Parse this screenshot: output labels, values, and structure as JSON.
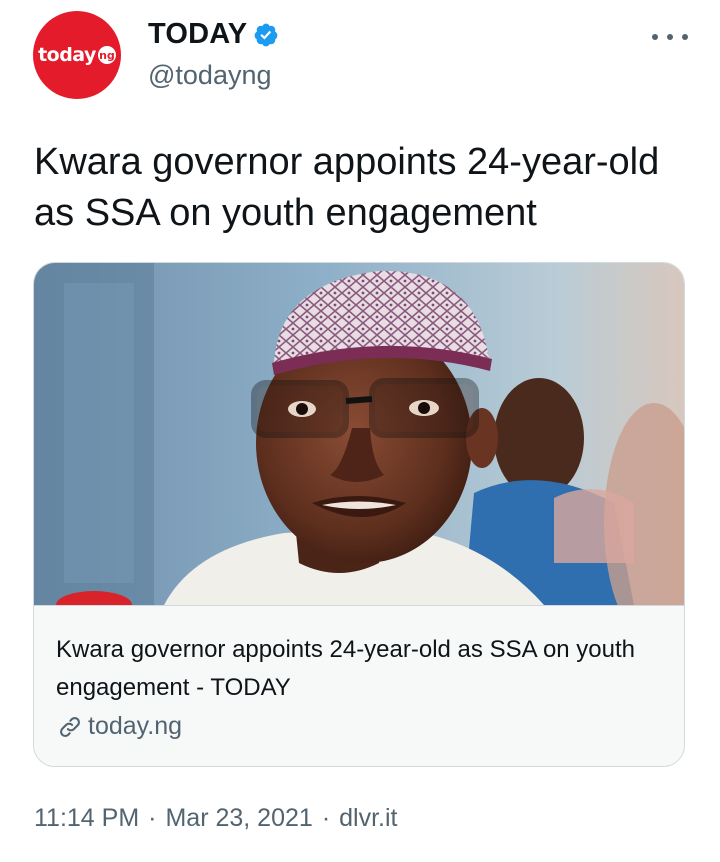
{
  "author": {
    "display_name": "TODAY",
    "handle": "@todayng",
    "avatar_logo_text": "today",
    "avatar_logo_badge": "ng",
    "verified_icon": "verified-badge-icon",
    "brand_color": "#e41b2b",
    "verified_color": "#1d9bf0"
  },
  "more_menu_icon": "more-horizontal-icon",
  "tweet": {
    "text": "Kwara governor appoints 24-year-old as SSA on youth engagement"
  },
  "card": {
    "image_description_icon": "news-photo",
    "title": "Kwara governor appoints 24-year-old as SSA on youth engagement - TODAY",
    "domain": "today.ng",
    "link_icon": "link-icon"
  },
  "meta": {
    "time": "11:14 PM",
    "date": "Mar 23, 2021",
    "separator": "·",
    "source": "dlvr.it"
  },
  "colors": {
    "text_primary": "#0f1419",
    "text_secondary": "#536471",
    "border": "#cfd9de",
    "card_bg": "#f7f9f9"
  }
}
